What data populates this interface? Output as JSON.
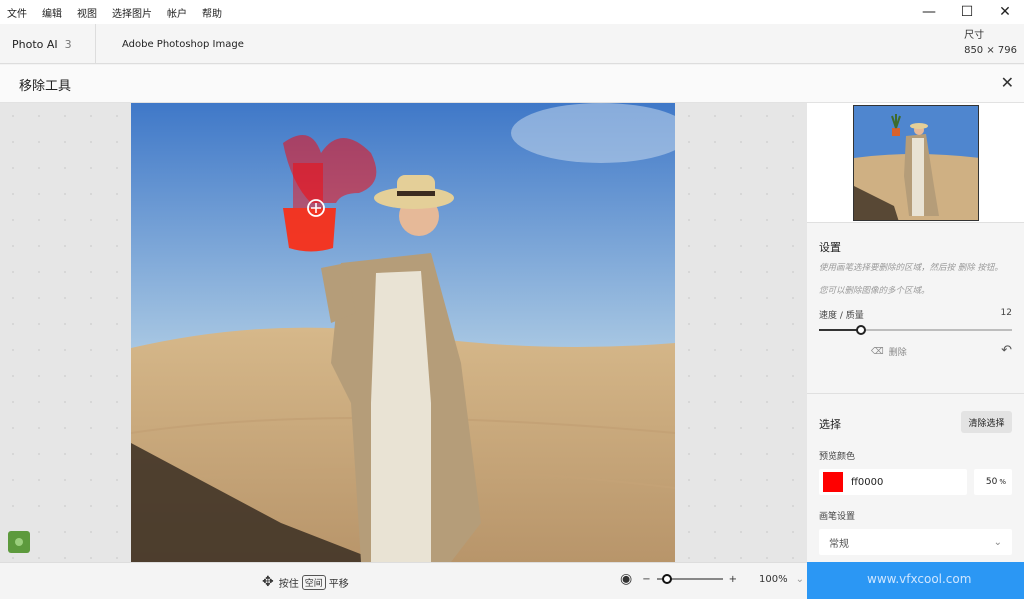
{
  "menu": [
    "文件",
    "编辑",
    "视图",
    "选择图片",
    "帐户",
    "帮助"
  ],
  "window": {
    "minimize": "—",
    "maximize": "☐",
    "close": "✕"
  },
  "tabs": {
    "app_name": "Photo AI",
    "count": "3",
    "file_name": "Adobe Photoshop Image"
  },
  "dimensions": {
    "label": "尺寸",
    "value": "850 × 796"
  },
  "tool": {
    "title": "移除工具",
    "close": "✕"
  },
  "settings": {
    "title": "设置",
    "desc1": "使用画笔选择要删除的区域，然后按 删除 按钮。",
    "desc2": "您可以删除图像的多个区域。",
    "slider_label": "速度 / 质量",
    "slider_value": "12",
    "slider_fraction": 0.22,
    "delete_label": "删除"
  },
  "selection": {
    "title": "选择",
    "clear_button": "清除选择",
    "preview_color_label": "预览颜色",
    "color_hex": "ff0000",
    "color_swatch": "#ff0000",
    "opacity_value": "50",
    "opacity_unit": "%",
    "brush_label": "画笔设置",
    "brush_value": "常规"
  },
  "bottom": {
    "hint_press": "按住",
    "hint_key": "空间",
    "hint_action": "平移",
    "zoom_value": "100%",
    "zoom_fraction": 0.15,
    "zoom_minus": "−",
    "zoom_plus": "+"
  },
  "watermark": "www.vfxcool.com"
}
